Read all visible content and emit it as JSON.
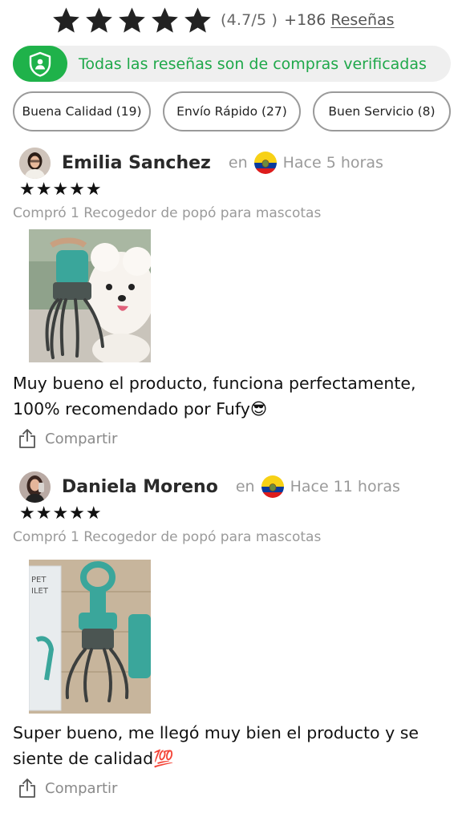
{
  "rating": {
    "stars": 5,
    "score_text": "(4.7/5 )",
    "count_text": "+186",
    "reviews_link": "Reseñas"
  },
  "verified_banner": {
    "icon": "verified-user-shield-icon",
    "text": "Todas las reseñas son de compras verificadas",
    "accent": "#1fb24a"
  },
  "filters": [
    {
      "label": "Buena Calidad (19)"
    },
    {
      "label": "Envío Rápido (27)"
    },
    {
      "label": "Buen Servicio (8)"
    }
  ],
  "reviews": [
    {
      "name": "Emilia Sanchez",
      "in_label": "en",
      "flag": "ecuador-flag",
      "time": "Hace 5 horas",
      "stars": "★★★★★",
      "purchase": "Compró 1 Recogedor de popó para mascotas",
      "photo": "white dog with teal pet waste scooper",
      "text": "Muy bueno el producto, funciona perfectamente, 100% recomendado por Fufy😎",
      "share_label": "Compartir"
    },
    {
      "name": "Daniela Moreno",
      "in_label": "en",
      "flag": "ecuador-flag",
      "time": "Hace 11 horas",
      "stars": "★★★★★",
      "purchase": "Compró 1 Recogedor de popó para mascotas",
      "photo": "teal pet waste scooper next to product box",
      "box_text": "PET\nILET",
      "text": "Super bueno, me llegó muy bien el producto y se siente de calidad💯",
      "share_label": "Compartir"
    }
  ],
  "colors": {
    "star": "#222222",
    "muted": "#9a9a9a",
    "green": "#1fb24a",
    "banner_bg": "#efefef"
  }
}
